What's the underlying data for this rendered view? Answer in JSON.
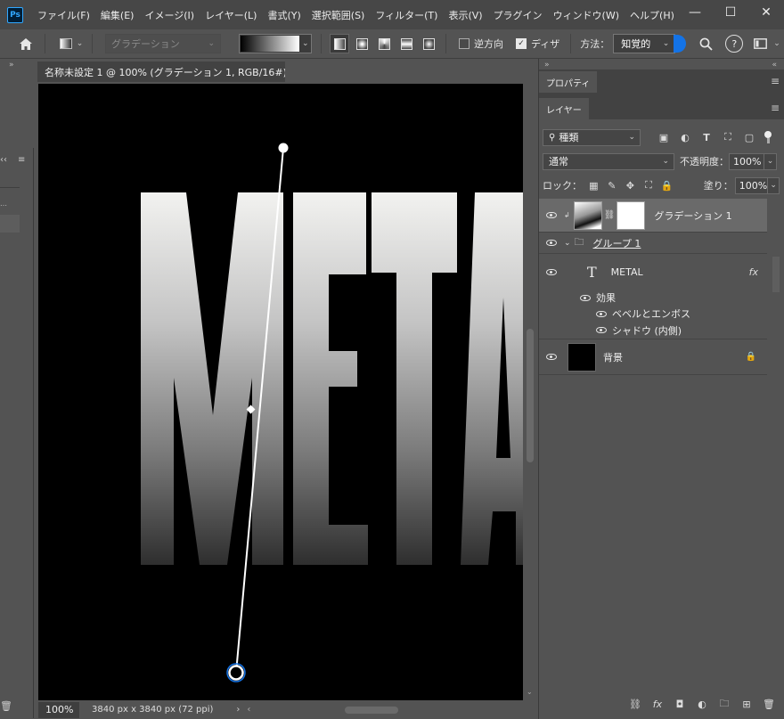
{
  "app": {
    "logo": "Ps"
  },
  "menu": [
    "ファイル(F)",
    "編集(E)",
    "イメージ(I)",
    "レイヤー(L)",
    "書式(Y)",
    "選択範囲(S)",
    "フィルター(T)",
    "表示(V)",
    "プラグイン",
    "ウィンドウ(W)",
    "ヘルプ(H)"
  ],
  "window_controls": {
    "minimize": "—",
    "maximize": "☐",
    "close": "✕"
  },
  "options": {
    "preset_placeholder": "グラデーション",
    "reverse_label": "逆方向",
    "reverse_checked": false,
    "dither_label": "ディザ",
    "dither_checked": true,
    "method_label": "方法：",
    "method_value": "知覚的",
    "accent_color": "#1473e6"
  },
  "document": {
    "tab_title": "名称未設定 1 @ 100% (グラデーション 1, RGB/16#) *",
    "canvas_text": "METAL",
    "zoom": "100%",
    "size_info": "3840 px x 3840 px (72 ppi)",
    "gradient_start_color": "#ffffff",
    "gradient_end_color": "#3a3a3a"
  },
  "panels": {
    "top_tab": "プロパティ",
    "layers_tab": "レイヤー",
    "kind_label": "種類",
    "blend_mode": "通常",
    "opacity_label": "不透明度：",
    "opacity_value": "100%",
    "lock_label": "ロック：",
    "fill_label": "塗り：",
    "fill_value": "100%"
  },
  "layers": [
    {
      "name": "グラデーション 1",
      "type": "gradient-fill",
      "visible": true,
      "selected": true
    },
    {
      "name": "グループ 1",
      "type": "group",
      "visible": true,
      "expanded": true
    },
    {
      "name": "METAL",
      "type": "text",
      "visible": true,
      "fx": "fx"
    },
    {
      "name": "効果",
      "type": "effects-header",
      "visible": true
    },
    {
      "name": "ベベルとエンボス",
      "type": "effect",
      "visible": true
    },
    {
      "name": "シャドウ (内側)",
      "type": "effect",
      "visible": true
    },
    {
      "name": "背景",
      "type": "background",
      "visible": true,
      "locked": true
    }
  ]
}
